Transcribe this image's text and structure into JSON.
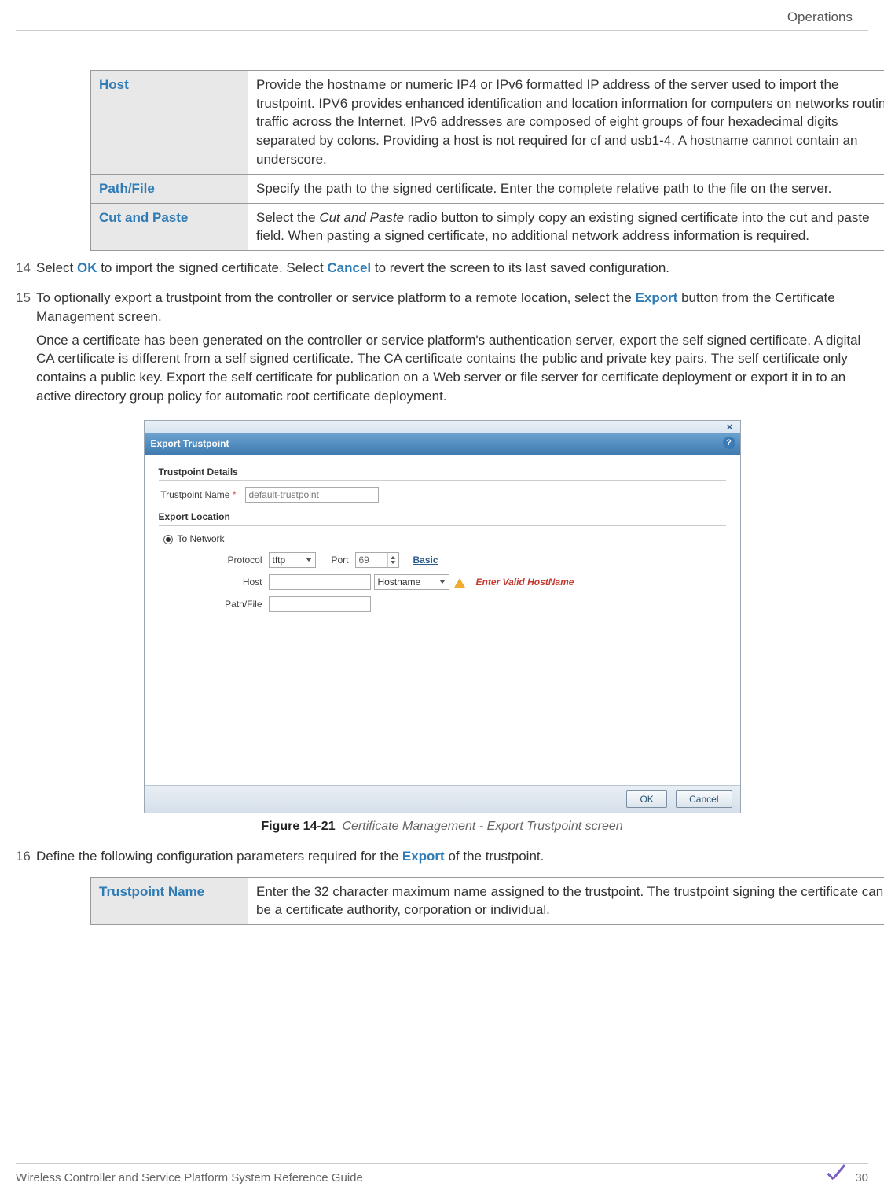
{
  "header": {
    "section": "Operations"
  },
  "table1": {
    "rows": [
      {
        "term": "Host",
        "desc": "Provide the hostname or numeric IP4 or IPv6 formatted IP address of the server used to import the trustpoint. IPV6 provides enhanced identification and location information for computers on networks routing traffic across the Internet. IPv6 addresses are composed of eight groups of four hexadecimal digits separated by colons. Providing a host is not required for cf and usb1-4. A hostname cannot contain an underscore."
      },
      {
        "term": "Path/File",
        "desc": "Specify the path to the signed certificate. Enter the complete relative path to the file on the server."
      },
      {
        "term": "Cut and Paste",
        "desc_pre": "Select the ",
        "desc_em": "Cut and Paste",
        "desc_post": " radio button to simply copy an existing signed certificate into the cut and paste field. When pasting a signed certificate, no additional network address information is required."
      }
    ]
  },
  "steps": {
    "s14": {
      "num": "14",
      "pre": "Select ",
      "kw1": "OK",
      "mid": " to import the signed certificate. Select ",
      "kw2": "Cancel",
      "post": " to revert the screen to its last saved configuration."
    },
    "s15": {
      "num": "15",
      "p1_pre": "To optionally export a trustpoint from the controller or service platform to a remote location, select the ",
      "p1_kw": "Export",
      "p1_post": " button from the Certificate Management screen.",
      "p2": "Once a certificate has been generated on the controller or service platform's authentication server, export the self signed certificate. A digital CA certificate is different from a self signed certificate. The CA certificate contains the public and private key pairs. The self certificate only contains a public key. Export the self certificate for publication on a Web server or file server for certificate deployment or export it in to an active directory group policy for automatic root certificate deployment."
    },
    "s16": {
      "num": "16",
      "pre": "Define the following configuration parameters required for the ",
      "kw": "Export",
      "post": " of the trustpoint."
    }
  },
  "dialog": {
    "title": "Export Trustpoint",
    "sec1": "Trustpoint Details",
    "tp_label": "Trustpoint Name",
    "tp_placeholder": "default-trustpoint",
    "sec2": "Export Location",
    "radio_label": "To Network",
    "proto_label": "Protocol",
    "proto_value": "tftp",
    "port_label": "Port",
    "port_value": "69",
    "basic_link": "Basic",
    "host_label": "Host",
    "host_sel": "Hostname",
    "host_error": "Enter Valid HostName",
    "path_label": "Path/File",
    "ok": "OK",
    "cancel": "Cancel"
  },
  "figure": {
    "label": "Figure 14-21",
    "desc": "Certificate Management - Export Trustpoint screen"
  },
  "table2": {
    "rows": [
      {
        "term": "Trustpoint Name",
        "desc": "Enter the 32 character maximum name assigned to the trustpoint. The trustpoint signing the certificate can be a certificate authority, corporation or individual."
      }
    ]
  },
  "footer": {
    "doc": "Wireless Controller and Service Platform System Reference Guide",
    "page": "30"
  }
}
